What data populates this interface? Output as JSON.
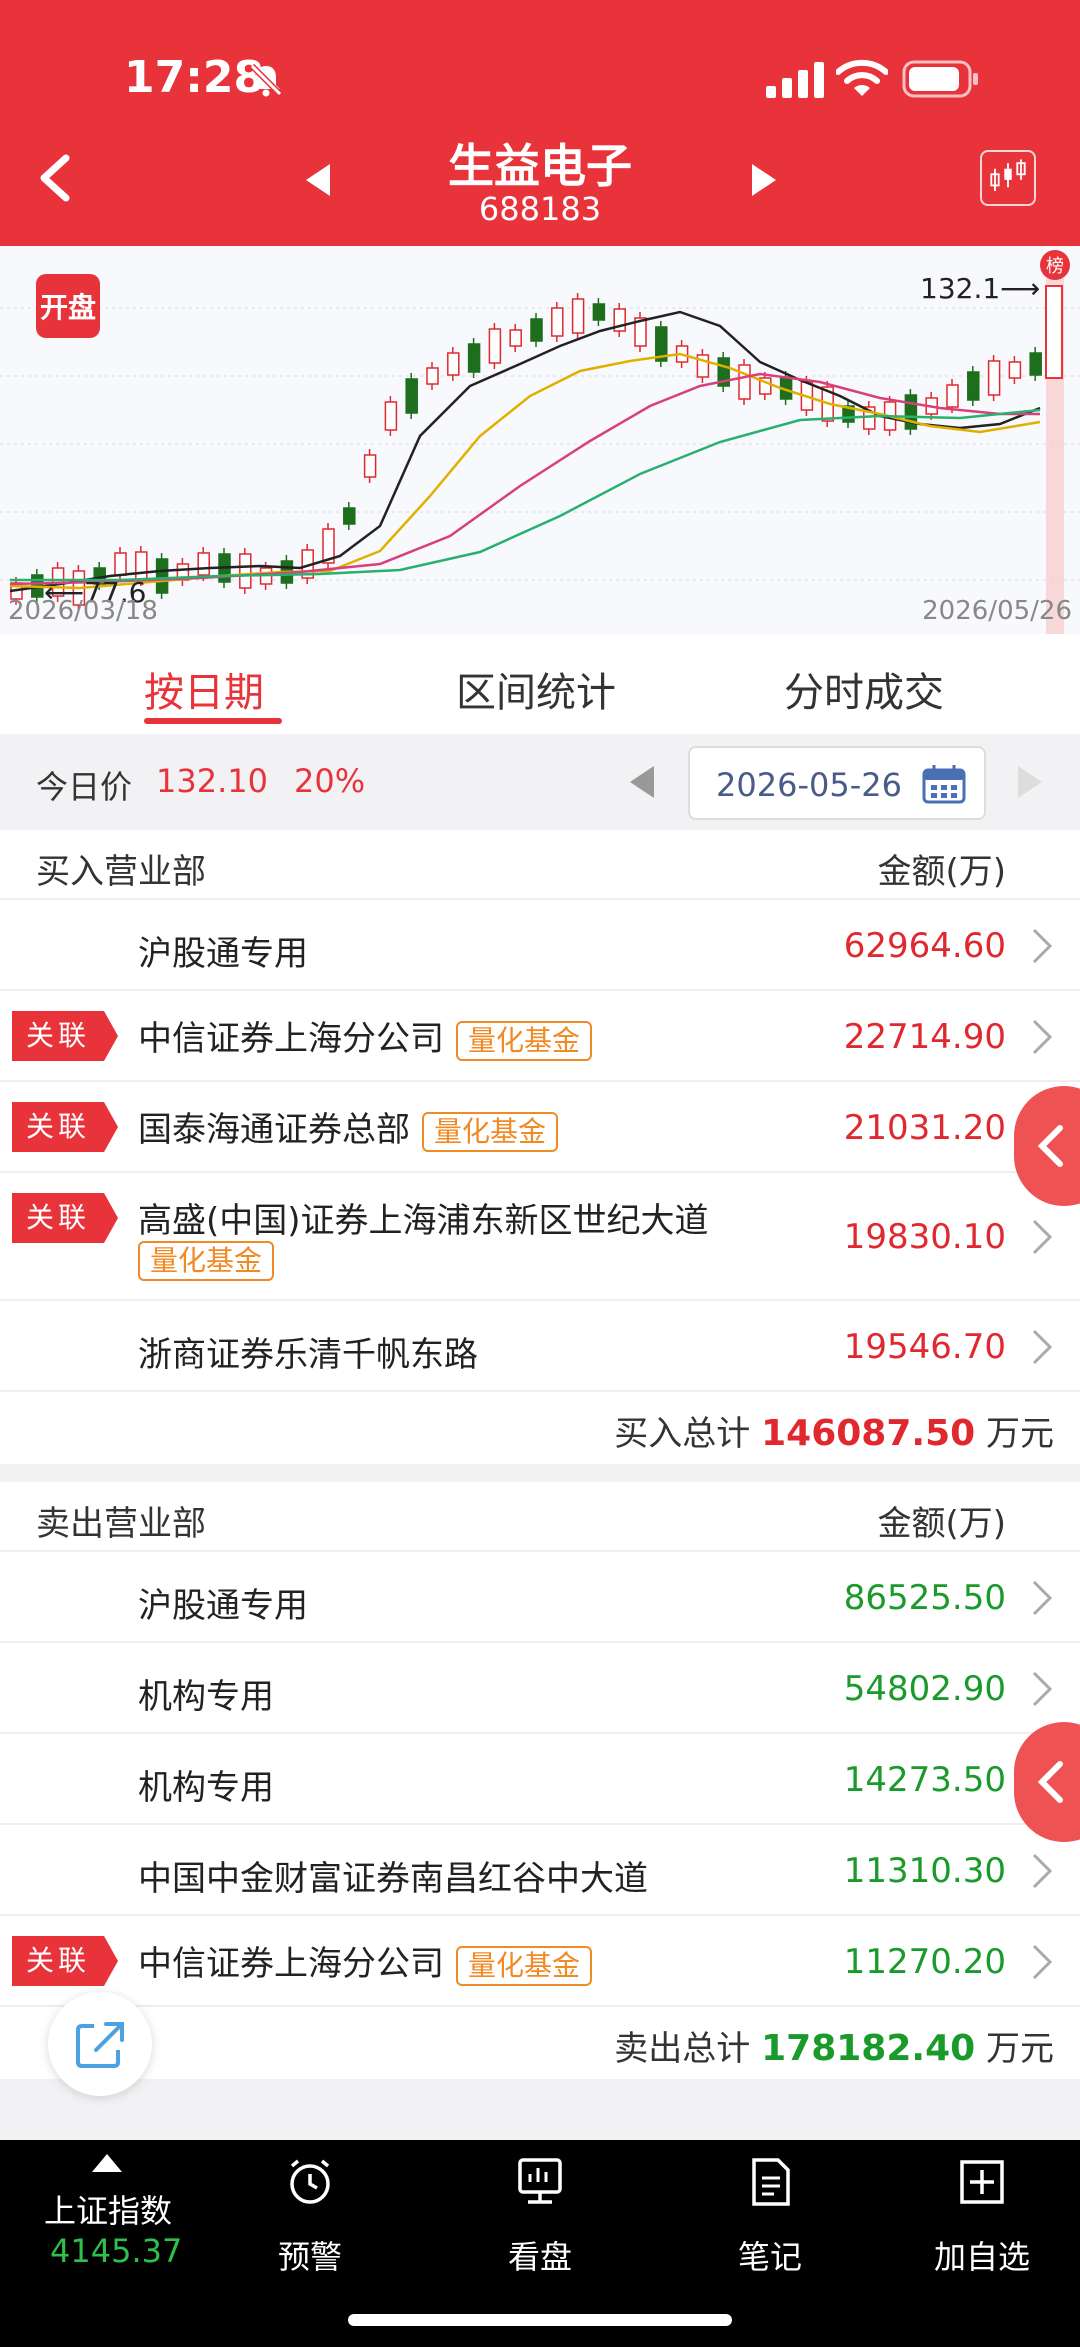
{
  "status": {
    "time": "17:28"
  },
  "header": {
    "name": "生益电子",
    "code": "688183"
  },
  "chart": {
    "badge": "开盘",
    "high_label": "132.1⟶",
    "low_label": "⟵77.6",
    "date_start": "2026/03/18",
    "date_end": "2026/05/26",
    "rank_badge": "榜"
  },
  "tabs": [
    {
      "label": "按日期",
      "active": true
    },
    {
      "label": "区间统计",
      "active": false
    },
    {
      "label": "分时成交",
      "active": false
    }
  ],
  "price": {
    "label": "今日价",
    "value": "132.10",
    "pct": "20%",
    "date": "2026-05-26"
  },
  "buy": {
    "title": "买入营业部",
    "col": "金额(万)",
    "rows": [
      {
        "name": "沪股通专用",
        "amount": "62964.60",
        "assoc": "",
        "quant": ""
      },
      {
        "name": "中信证券上海分公司",
        "amount": "22714.90",
        "assoc": "关联",
        "quant": "量化基金"
      },
      {
        "name": "国泰海通证券总部",
        "amount": "21031.20",
        "assoc": "关联",
        "quant": "量化基金"
      },
      {
        "name": "高盛(中国)证券上海浦东新区世纪大道",
        "amount": "19830.10",
        "assoc": "关联",
        "quant": "量化基金"
      },
      {
        "name": "浙商证券乐清千帆东路",
        "amount": "19546.70",
        "assoc": "",
        "quant": ""
      }
    ],
    "total_label": "买入总计",
    "total": "146087.50",
    "unit": "万元"
  },
  "sell": {
    "title": "卖出营业部",
    "col": "金额(万)",
    "rows": [
      {
        "name": "沪股通专用",
        "amount": "86525.50",
        "assoc": "",
        "quant": ""
      },
      {
        "name": "机构专用",
        "amount": "54802.90",
        "assoc": "",
        "quant": ""
      },
      {
        "name": "机构专用",
        "amount": "14273.50",
        "assoc": "",
        "quant": ""
      },
      {
        "name": "中国中金财富证券南昌红谷中大道",
        "amount": "11310.30",
        "assoc": "",
        "quant": ""
      },
      {
        "name": "中信证券上海分公司",
        "amount": "11270.20",
        "assoc": "关联",
        "quant": "量化基金"
      }
    ],
    "total_label": "卖出总计",
    "total": "178182.40",
    "unit": "万元"
  },
  "bottom_nav": {
    "index_label": "上证指数",
    "index_value": "4145.37",
    "items": [
      "预警",
      "看盘",
      "笔记",
      "加自选"
    ]
  },
  "colors": {
    "brand_red": "#e8333a",
    "up_red": "#e0282f",
    "down_green": "#1a9a2a",
    "quant_orange": "#f08a24"
  }
}
